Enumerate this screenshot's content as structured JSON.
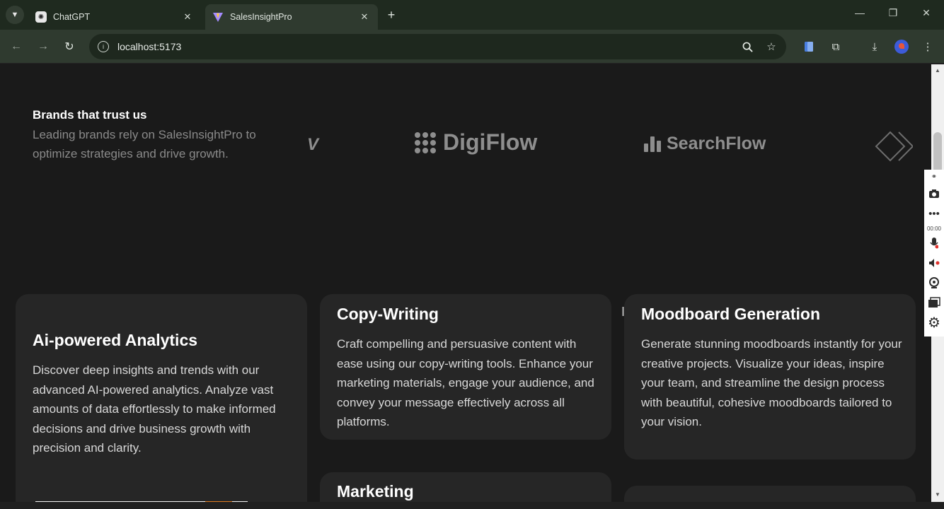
{
  "browser": {
    "tabs": [
      {
        "title": "ChatGPT",
        "favicon": "chatgpt-icon",
        "active": false
      },
      {
        "title": "SalesInsightPro",
        "favicon": "vite-icon",
        "active": true
      }
    ],
    "address": "localhost:5173",
    "colors": {
      "frame": "#1f2a1f",
      "toolbar": "#2f3a2f"
    }
  },
  "brands": {
    "title": "Brands that trust us",
    "subtitle": "Leading brands rely on SalesInsightPro to optimize strategies and drive growth.",
    "logos": [
      "V",
      "DigiFlow",
      "SearchFlow"
    ]
  },
  "features": [
    {
      "title": "Ai-powered Analytics",
      "body": "Discover deep insights and trends with our advanced AI-powered analytics. Analyze vast amounts of data effortlessly to make informed decisions and drive business growth with precision and clarity."
    },
    {
      "title": "Copy-Writing",
      "body": "Craft compelling and persuasive content with ease using our copy-writing tools. Enhance your marketing materials, engage your audience, and convey your message effectively across all platforms."
    },
    {
      "title": "Moodboard Generation",
      "body": "Generate stunning moodboards instantly for your creative projects. Visualize your ideas, inspire your team, and streamline the design process with beautiful, cohesive moodboards tailored to your vision."
    },
    {
      "title": "Marketing",
      "body": ""
    }
  ],
  "recorder": {
    "time": "00:00"
  },
  "colors": {
    "page_bg": "#1a1a1a",
    "card_bg": "#262626",
    "muted_text": "#8a8a8a"
  }
}
